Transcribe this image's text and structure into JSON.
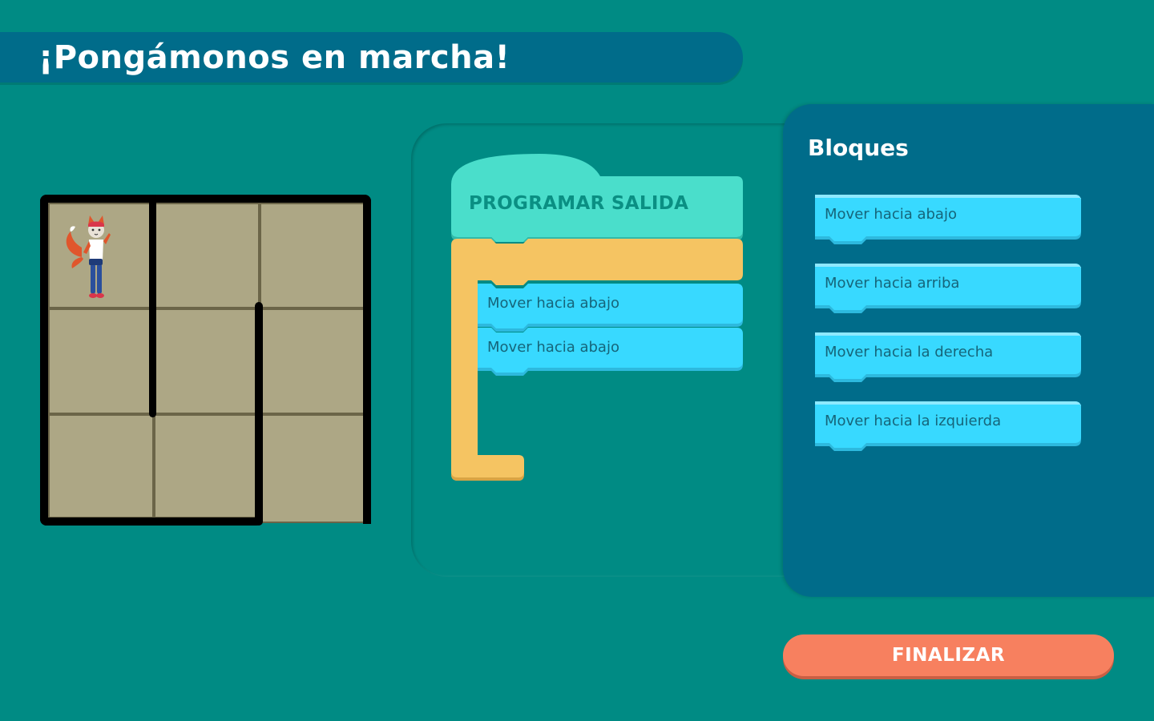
{
  "header": {
    "title": "¡Pongámonos en marcha!"
  },
  "maze": {
    "rows": 3,
    "columns": 3,
    "character": "fox-character"
  },
  "program": {
    "start_block_label": "PROGRAMAR SALIDA",
    "blocks": [
      {
        "label": "Mover hacia abajo"
      },
      {
        "label": "Mover hacia abajo"
      }
    ]
  },
  "palette": {
    "title": "Bloques",
    "blocks": [
      {
        "label": "Mover hacia abajo"
      },
      {
        "label": "Mover hacia arriba"
      },
      {
        "label": "Mover hacia la derecha"
      },
      {
        "label": "Mover hacia la izquierda"
      }
    ]
  },
  "finish_button": {
    "label": "FINALIZAR"
  },
  "colors": {
    "background": "#008b84",
    "panel": "#006c8a",
    "start_block": "#4adecb",
    "loop_block": "#f5c462",
    "motion_block": "#38d9ff",
    "finish": "#f7805f",
    "maze_tile": "#ada785"
  }
}
